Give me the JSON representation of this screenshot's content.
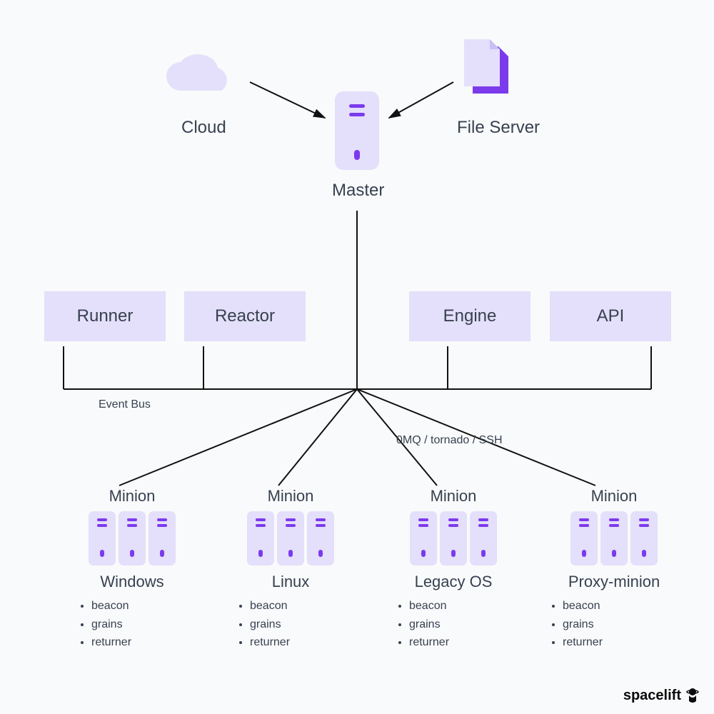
{
  "top": {
    "cloud_label": "Cloud",
    "file_server_label": "File Server",
    "master_label": "Master"
  },
  "bus": {
    "runner": "Runner",
    "reactor": "Reactor",
    "engine": "Engine",
    "api": "API",
    "event_bus_label": "Event Bus",
    "transport_label": "0MQ / tornado / SSH"
  },
  "minions": [
    {
      "title": "Minion",
      "os": "Windows",
      "items": [
        "beacon",
        "grains",
        "returner"
      ]
    },
    {
      "title": "Minion",
      "os": "Linux",
      "items": [
        "beacon",
        "grains",
        "returner"
      ]
    },
    {
      "title": "Minion",
      "os": "Legacy OS",
      "items": [
        "beacon",
        "grains",
        "returner"
      ]
    },
    {
      "title": "Minion",
      "os": "Proxy-minion",
      "items": [
        "beacon",
        "grains",
        "returner"
      ]
    }
  ],
  "brand": "spacelift",
  "colors": {
    "box_fill": "#e4dffa",
    "accent": "#7c3aed",
    "text": "#374151",
    "bg": "#f9fafb"
  }
}
